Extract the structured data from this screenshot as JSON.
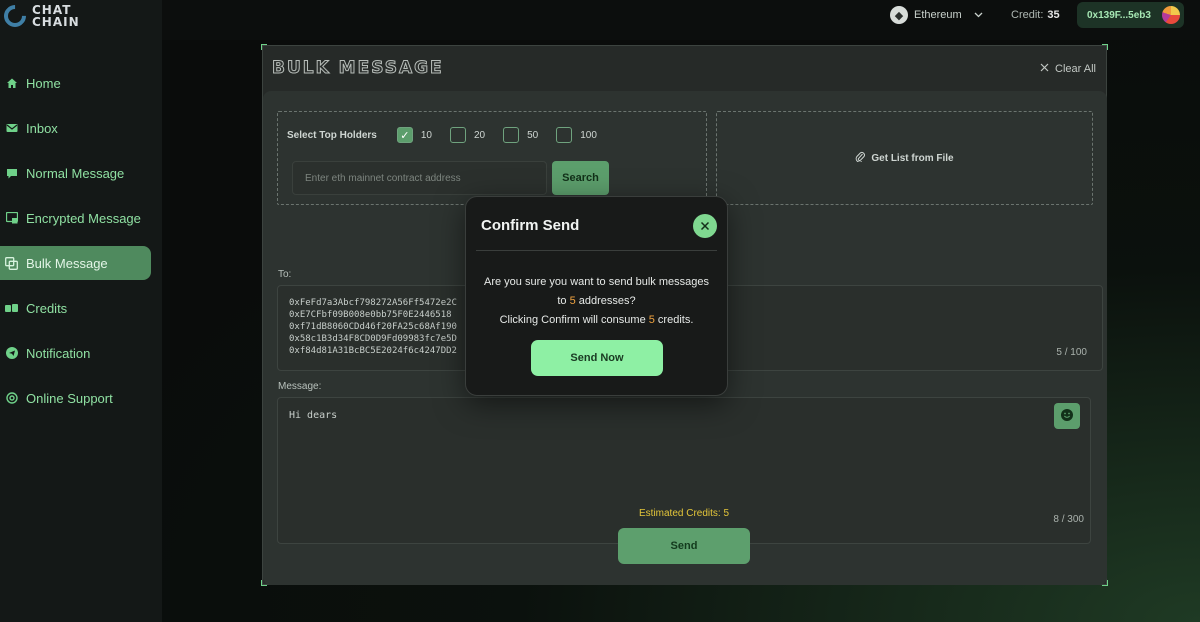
{
  "app": {
    "logo_line1": "CHAT",
    "logo_line2": "CHAIN"
  },
  "sidebar": {
    "items": [
      {
        "label": "Home",
        "icon": "home-icon"
      },
      {
        "label": "Inbox",
        "icon": "inbox-icon"
      },
      {
        "label": "Normal Message",
        "icon": "message-icon"
      },
      {
        "label": "Encrypted Message",
        "icon": "lock-message-icon"
      },
      {
        "label": "Bulk Message",
        "icon": "copy-icon",
        "active": true
      },
      {
        "label": "Credits",
        "icon": "credits-icon"
      },
      {
        "label": "Notification",
        "icon": "send-icon"
      },
      {
        "label": "Online Support",
        "icon": "support-icon"
      }
    ]
  },
  "topbar": {
    "network": "Ethereum",
    "credit_label": "Credit:",
    "credit_value": "35",
    "wallet": "0x139F...5eb3"
  },
  "panel": {
    "title": "BULK MESSAGE",
    "clear_all": "Clear All",
    "select_label": "Select Top Holders",
    "holder_options": [
      {
        "label": "10",
        "checked": true
      },
      {
        "label": "20",
        "checked": false
      },
      {
        "label": "50",
        "checked": false
      },
      {
        "label": "100",
        "checked": false
      }
    ],
    "contract_placeholder": "Enter eth mainnet contract address",
    "search_button": "Search",
    "file_button": "Get List from File",
    "to_label": "To:",
    "addresses": [
      "0xFeFd7a3Abcf798272A56Ff5472e2C",
      "0xE7CFbf09B008e0bb75F0E2446518",
      "0xf71dB8060CDd46f20FA25c68Af190",
      "0x58c1B3d34F8CD0D9Fd09983fc7e5D",
      "0xf84d81A31BcBC5E2024f6c4247DD2"
    ],
    "to_counter": "5 / 100",
    "message_label": "Message:",
    "message_text": "Hi dears",
    "message_counter": "8 / 300",
    "estimated_credits": "Estimated Credits: 5",
    "send_button": "Send"
  },
  "modal": {
    "title": "Confirm Send",
    "line1": "Are you sure you want to send bulk messages",
    "line2_prefix": "to ",
    "line2_count": "5",
    "line2_suffix": " addresses?",
    "line3_prefix": "Clicking Confirm will consume ",
    "line3_count": "5",
    "line3_suffix": " credits.",
    "send_now": "Send Now"
  },
  "colors": {
    "accent": "#5c9e6c",
    "accent_light": "#8ef0a4",
    "highlight": "#f0a340",
    "estimated": "#e4c63a"
  }
}
